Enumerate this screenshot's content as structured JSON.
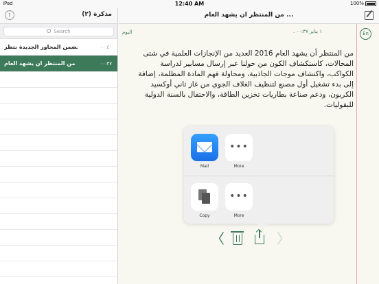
{
  "status_bar": {
    "carrier": "iPad",
    "time": "12:40 AM",
    "battery": "100%"
  },
  "sidebar": {
    "title": "مذكرة (٢)",
    "search_placeholder": "Search",
    "notes": [
      {
        "title": "فضمن المحاور الجديدة بتطر ...",
        "time": "٠٠:٤٠"
      },
      {
        "title": "من المنتظر ان يشهد العام ...",
        "time": "٠٠:٣٧"
      }
    ]
  },
  "editor": {
    "title": "من المنتظر ان يشهد العام ...",
    "today_label": "اليوم",
    "date_label": "١ يناير ٠٠:٣٧ ،",
    "lang_button": "En",
    "body": "من المنتظر أن يشهد العام 2016 العديد من الإنجازات العلمية في شتى المجالات، كاستكشاف الكون من حولنا عبر إرسال مسابير لدراسة الكواكب، واكتشاف موجات الجاذبية، ومحاولة فهم المادة المظلمة، إضافة إلى بدء تشغيل أول مصنع لتنظيف الغلاف الجوي من غاز ثاني أوكسيد الكربون، ودعم صناعة بطاريات تخزين الطاقة، والاحتفال بالسنة الدولية للبقوليات."
  },
  "share_sheet": {
    "row1": [
      {
        "label": "Mail",
        "icon": "mail-icon"
      },
      {
        "label": "More",
        "icon": "more-icon"
      }
    ],
    "row2": [
      {
        "label": "Copy",
        "icon": "copy-icon"
      },
      {
        "label": "More",
        "icon": "more-icon"
      }
    ]
  },
  "toolbar": {
    "back_glyph": "〈",
    "forward_glyph": "〉"
  },
  "colors": {
    "accent": "#3d7a5a",
    "selected_row": "#3d7a5a",
    "margin_line": "#e9a7a7",
    "mail_tile": "#1a6fe8"
  }
}
